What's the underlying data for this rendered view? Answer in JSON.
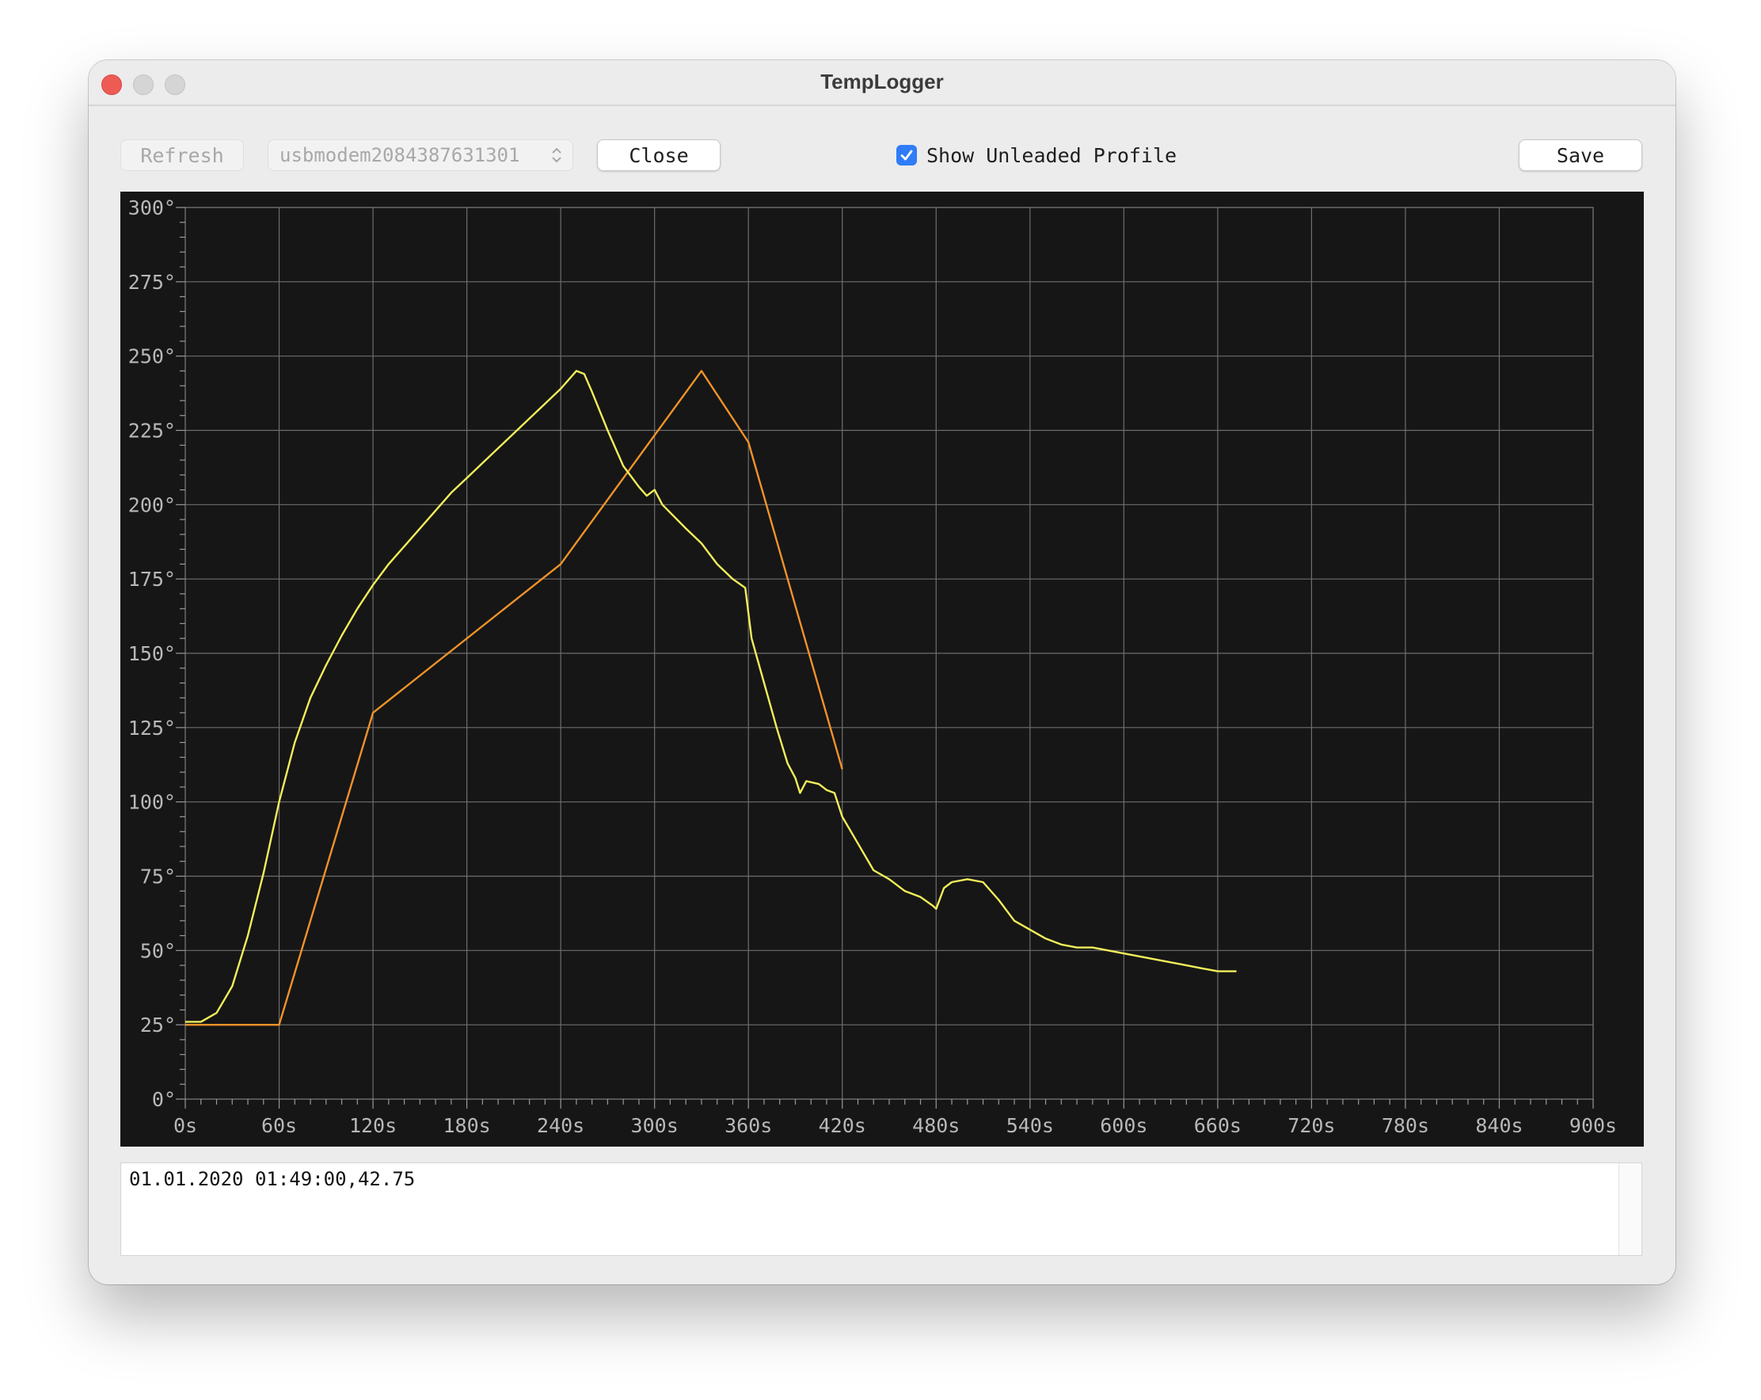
{
  "window": {
    "title": "TempLogger"
  },
  "toolbar": {
    "refresh_label": "Refresh",
    "port_value": "usbmodem2084387631301",
    "close_label": "Close",
    "profile_checkbox_label": "Show Unleaded Profile",
    "profile_checked": true,
    "save_label": "Save"
  },
  "log": {
    "text": "01.01.2020 01:49:00,42.75"
  },
  "chart_data": {
    "type": "line",
    "xlim": [
      0,
      900
    ],
    "ylim": [
      0,
      300
    ],
    "x_ticks": [
      0,
      60,
      120,
      180,
      240,
      300,
      360,
      420,
      480,
      540,
      600,
      660,
      720,
      780,
      840,
      900
    ],
    "x_tick_labels": [
      "0s",
      "60s",
      "120s",
      "180s",
      "240s",
      "300s",
      "360s",
      "420s",
      "480s",
      "540s",
      "600s",
      "660s",
      "720s",
      "780s",
      "840s",
      "900s"
    ],
    "y_ticks": [
      0,
      25,
      50,
      75,
      100,
      125,
      150,
      175,
      200,
      225,
      250,
      275,
      300
    ],
    "y_tick_labels": [
      "0°",
      "25°",
      "50°",
      "75°",
      "100°",
      "125°",
      "150°",
      "175°",
      "200°",
      "225°",
      "250°",
      "275°",
      "300°"
    ],
    "grid": true,
    "series": [
      {
        "color": "#f0932a",
        "points": [
          [
            0,
            25
          ],
          [
            60,
            25
          ],
          [
            120,
            130
          ],
          [
            240,
            180
          ],
          [
            330,
            245
          ],
          [
            360,
            221
          ],
          [
            420,
            111
          ]
        ]
      },
      {
        "color": "#f2ee5a",
        "points": [
          [
            0,
            26
          ],
          [
            10,
            26
          ],
          [
            20,
            29
          ],
          [
            30,
            38
          ],
          [
            40,
            55
          ],
          [
            50,
            76
          ],
          [
            60,
            100
          ],
          [
            70,
            120
          ],
          [
            80,
            135
          ],
          [
            90,
            146
          ],
          [
            100,
            156
          ],
          [
            110,
            165
          ],
          [
            120,
            173
          ],
          [
            130,
            180
          ],
          [
            140,
            186
          ],
          [
            150,
            192
          ],
          [
            160,
            198
          ],
          [
            170,
            204
          ],
          [
            180,
            209
          ],
          [
            190,
            214
          ],
          [
            200,
            219
          ],
          [
            210,
            224
          ],
          [
            220,
            229
          ],
          [
            230,
            234
          ],
          [
            240,
            239
          ],
          [
            250,
            245
          ],
          [
            255,
            244
          ],
          [
            260,
            238
          ],
          [
            270,
            225
          ],
          [
            280,
            213
          ],
          [
            290,
            206
          ],
          [
            295,
            203
          ],
          [
            300,
            205
          ],
          [
            305,
            200
          ],
          [
            320,
            192
          ],
          [
            330,
            187
          ],
          [
            340,
            180
          ],
          [
            350,
            175
          ],
          [
            358,
            172
          ],
          [
            362,
            155
          ],
          [
            370,
            140
          ],
          [
            378,
            125
          ],
          [
            385,
            113
          ],
          [
            390,
            108
          ],
          [
            393,
            103
          ],
          [
            397,
            107
          ],
          [
            405,
            106
          ],
          [
            410,
            104
          ],
          [
            415,
            103
          ],
          [
            420,
            95
          ],
          [
            430,
            86
          ],
          [
            440,
            77
          ],
          [
            450,
            74
          ],
          [
            460,
            70
          ],
          [
            470,
            68
          ],
          [
            478,
            65
          ],
          [
            480,
            64
          ],
          [
            485,
            71
          ],
          [
            490,
            73
          ],
          [
            500,
            74
          ],
          [
            510,
            73
          ],
          [
            520,
            67
          ],
          [
            530,
            60
          ],
          [
            540,
            57
          ],
          [
            550,
            54
          ],
          [
            560,
            52
          ],
          [
            570,
            51
          ],
          [
            580,
            51
          ],
          [
            590,
            50
          ],
          [
            600,
            49
          ],
          [
            610,
            48
          ],
          [
            620,
            47
          ],
          [
            630,
            46
          ],
          [
            640,
            45
          ],
          [
            650,
            44
          ],
          [
            660,
            43
          ],
          [
            672,
            43
          ]
        ]
      }
    ]
  }
}
